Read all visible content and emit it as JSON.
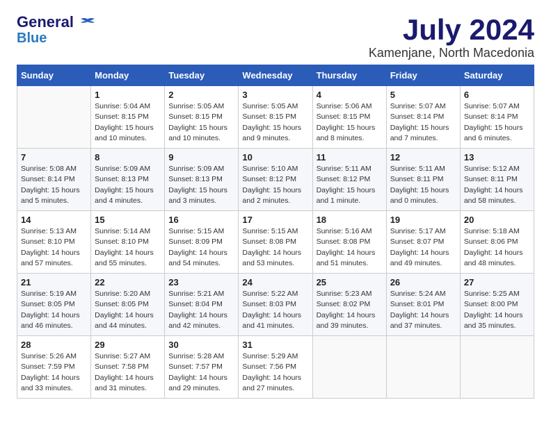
{
  "header": {
    "logo_line1": "General",
    "logo_line2": "Blue",
    "month": "July 2024",
    "location": "Kamenjane, North Macedonia"
  },
  "weekdays": [
    "Sunday",
    "Monday",
    "Tuesday",
    "Wednesday",
    "Thursday",
    "Friday",
    "Saturday"
  ],
  "weeks": [
    [
      {
        "day": "",
        "info": ""
      },
      {
        "day": "1",
        "info": "Sunrise: 5:04 AM\nSunset: 8:15 PM\nDaylight: 15 hours\nand 10 minutes."
      },
      {
        "day": "2",
        "info": "Sunrise: 5:05 AM\nSunset: 8:15 PM\nDaylight: 15 hours\nand 10 minutes."
      },
      {
        "day": "3",
        "info": "Sunrise: 5:05 AM\nSunset: 8:15 PM\nDaylight: 15 hours\nand 9 minutes."
      },
      {
        "day": "4",
        "info": "Sunrise: 5:06 AM\nSunset: 8:15 PM\nDaylight: 15 hours\nand 8 minutes."
      },
      {
        "day": "5",
        "info": "Sunrise: 5:07 AM\nSunset: 8:14 PM\nDaylight: 15 hours\nand 7 minutes."
      },
      {
        "day": "6",
        "info": "Sunrise: 5:07 AM\nSunset: 8:14 PM\nDaylight: 15 hours\nand 6 minutes."
      }
    ],
    [
      {
        "day": "7",
        "info": "Sunrise: 5:08 AM\nSunset: 8:14 PM\nDaylight: 15 hours\nand 5 minutes."
      },
      {
        "day": "8",
        "info": "Sunrise: 5:09 AM\nSunset: 8:13 PM\nDaylight: 15 hours\nand 4 minutes."
      },
      {
        "day": "9",
        "info": "Sunrise: 5:09 AM\nSunset: 8:13 PM\nDaylight: 15 hours\nand 3 minutes."
      },
      {
        "day": "10",
        "info": "Sunrise: 5:10 AM\nSunset: 8:12 PM\nDaylight: 15 hours\nand 2 minutes."
      },
      {
        "day": "11",
        "info": "Sunrise: 5:11 AM\nSunset: 8:12 PM\nDaylight: 15 hours\nand 1 minute."
      },
      {
        "day": "12",
        "info": "Sunrise: 5:11 AM\nSunset: 8:11 PM\nDaylight: 15 hours\nand 0 minutes."
      },
      {
        "day": "13",
        "info": "Sunrise: 5:12 AM\nSunset: 8:11 PM\nDaylight: 14 hours\nand 58 minutes."
      }
    ],
    [
      {
        "day": "14",
        "info": "Sunrise: 5:13 AM\nSunset: 8:10 PM\nDaylight: 14 hours\nand 57 minutes."
      },
      {
        "day": "15",
        "info": "Sunrise: 5:14 AM\nSunset: 8:10 PM\nDaylight: 14 hours\nand 55 minutes."
      },
      {
        "day": "16",
        "info": "Sunrise: 5:15 AM\nSunset: 8:09 PM\nDaylight: 14 hours\nand 54 minutes."
      },
      {
        "day": "17",
        "info": "Sunrise: 5:15 AM\nSunset: 8:08 PM\nDaylight: 14 hours\nand 53 minutes."
      },
      {
        "day": "18",
        "info": "Sunrise: 5:16 AM\nSunset: 8:08 PM\nDaylight: 14 hours\nand 51 minutes."
      },
      {
        "day": "19",
        "info": "Sunrise: 5:17 AM\nSunset: 8:07 PM\nDaylight: 14 hours\nand 49 minutes."
      },
      {
        "day": "20",
        "info": "Sunrise: 5:18 AM\nSunset: 8:06 PM\nDaylight: 14 hours\nand 48 minutes."
      }
    ],
    [
      {
        "day": "21",
        "info": "Sunrise: 5:19 AM\nSunset: 8:05 PM\nDaylight: 14 hours\nand 46 minutes."
      },
      {
        "day": "22",
        "info": "Sunrise: 5:20 AM\nSunset: 8:05 PM\nDaylight: 14 hours\nand 44 minutes."
      },
      {
        "day": "23",
        "info": "Sunrise: 5:21 AM\nSunset: 8:04 PM\nDaylight: 14 hours\nand 42 minutes."
      },
      {
        "day": "24",
        "info": "Sunrise: 5:22 AM\nSunset: 8:03 PM\nDaylight: 14 hours\nand 41 minutes."
      },
      {
        "day": "25",
        "info": "Sunrise: 5:23 AM\nSunset: 8:02 PM\nDaylight: 14 hours\nand 39 minutes."
      },
      {
        "day": "26",
        "info": "Sunrise: 5:24 AM\nSunset: 8:01 PM\nDaylight: 14 hours\nand 37 minutes."
      },
      {
        "day": "27",
        "info": "Sunrise: 5:25 AM\nSunset: 8:00 PM\nDaylight: 14 hours\nand 35 minutes."
      }
    ],
    [
      {
        "day": "28",
        "info": "Sunrise: 5:26 AM\nSunset: 7:59 PM\nDaylight: 14 hours\nand 33 minutes."
      },
      {
        "day": "29",
        "info": "Sunrise: 5:27 AM\nSunset: 7:58 PM\nDaylight: 14 hours\nand 31 minutes."
      },
      {
        "day": "30",
        "info": "Sunrise: 5:28 AM\nSunset: 7:57 PM\nDaylight: 14 hours\nand 29 minutes."
      },
      {
        "day": "31",
        "info": "Sunrise: 5:29 AM\nSunset: 7:56 PM\nDaylight: 14 hours\nand 27 minutes."
      },
      {
        "day": "",
        "info": ""
      },
      {
        "day": "",
        "info": ""
      },
      {
        "day": "",
        "info": ""
      }
    ]
  ]
}
